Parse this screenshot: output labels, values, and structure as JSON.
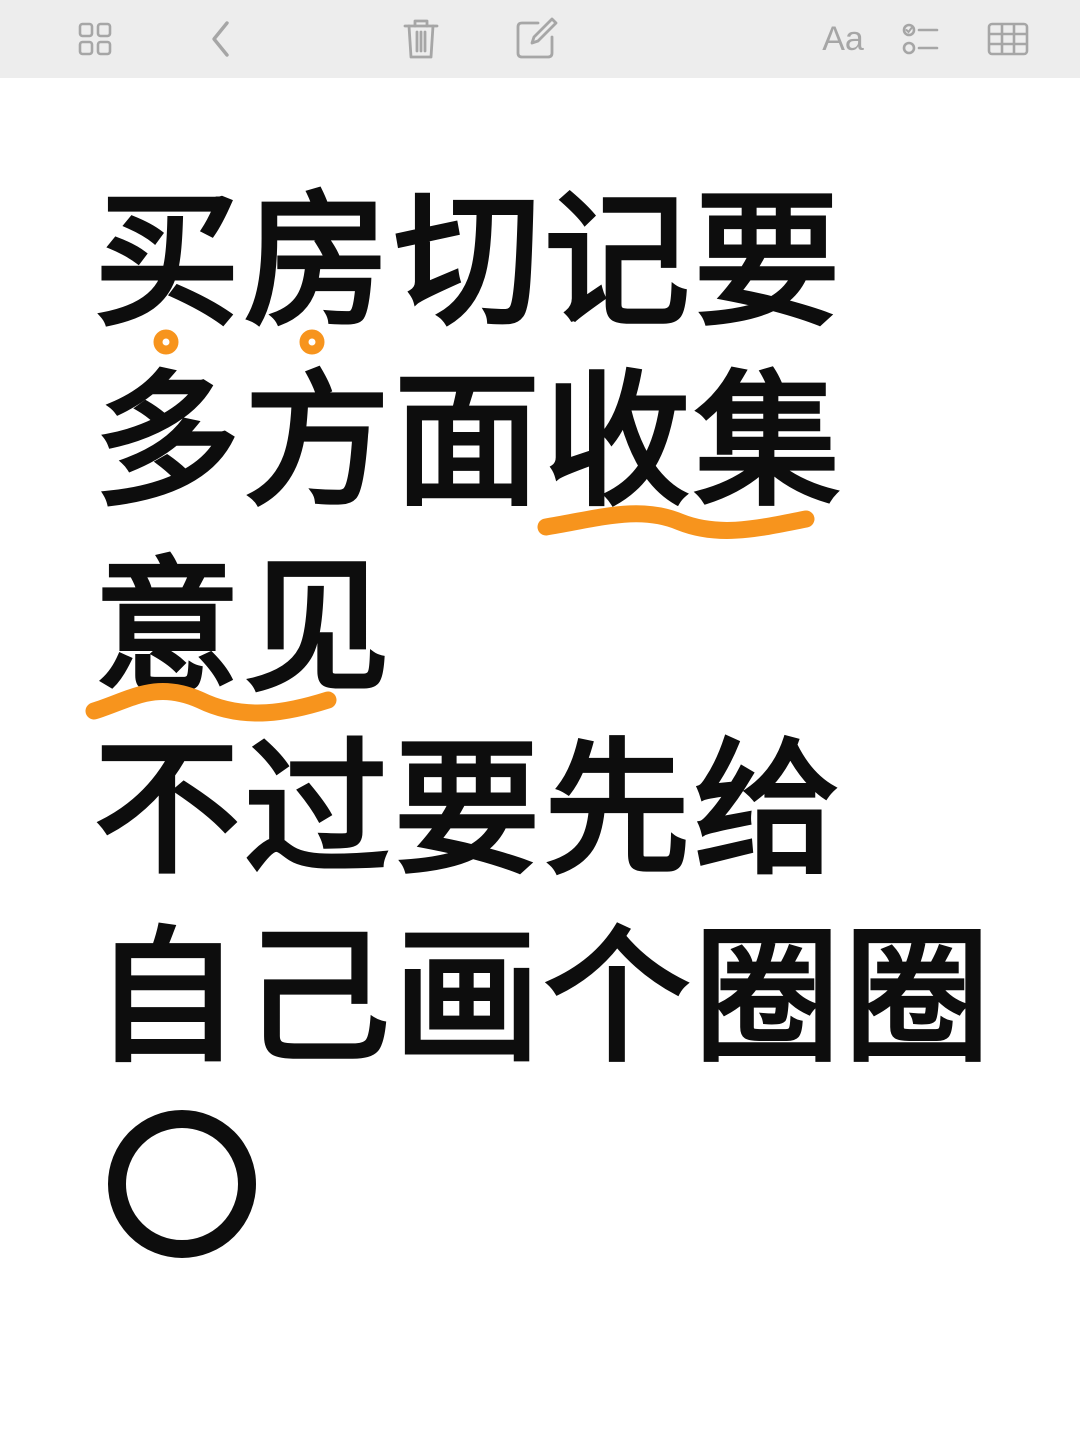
{
  "toolbar": {
    "font_label": "Aa"
  },
  "note": {
    "lines": [
      "买房切记要",
      "多方面收集",
      "意见",
      "不过要先给",
      "自己画个圈圈"
    ]
  },
  "colors": {
    "toolbar_bg": "#ededed",
    "icon": "#a6a6a6",
    "text": "#0d0d0d",
    "highlight_ink": "#f7941d"
  }
}
